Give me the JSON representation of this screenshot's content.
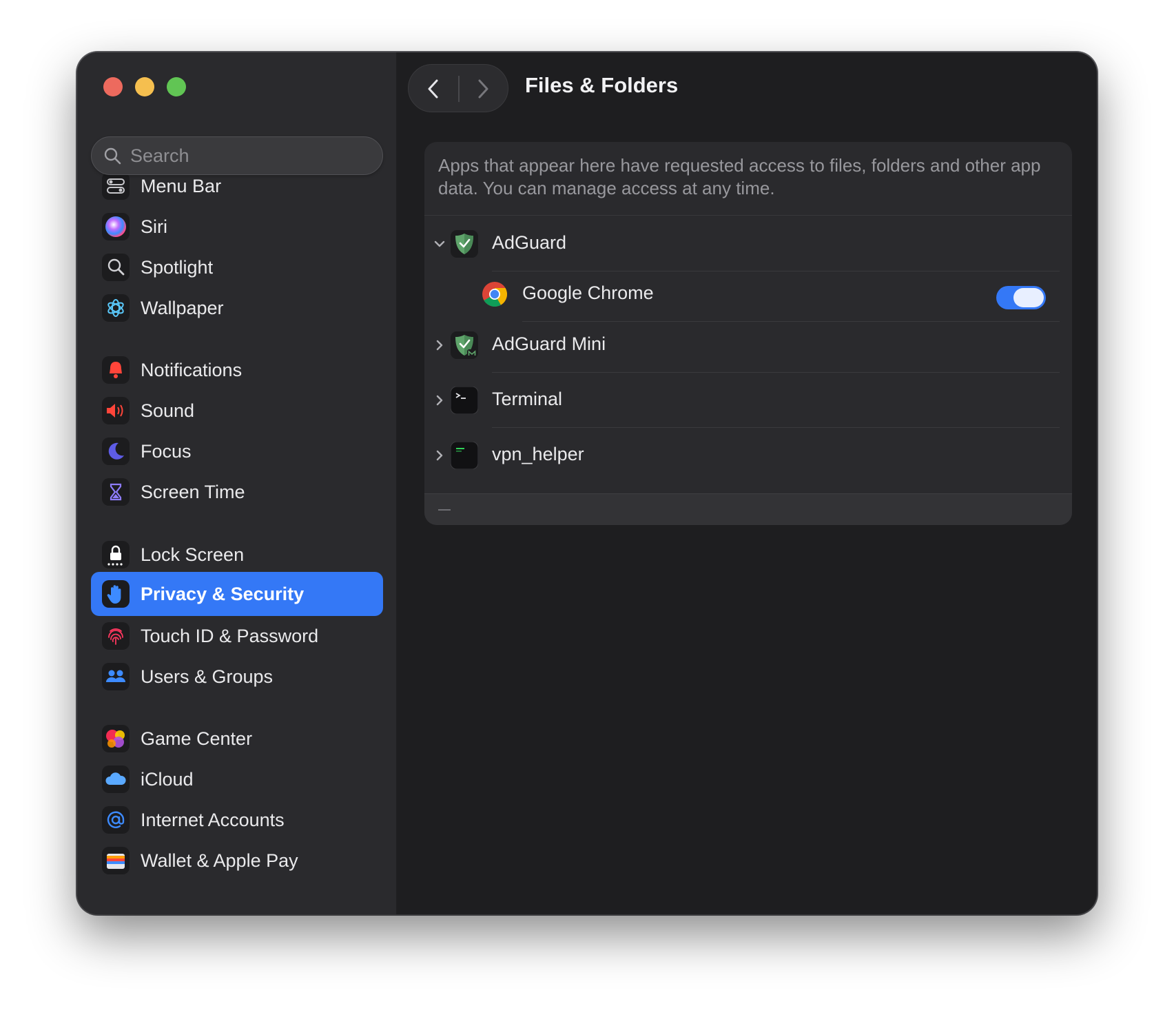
{
  "window": {
    "title": "Files & Folders"
  },
  "search": {
    "placeholder": "Search"
  },
  "sidebar": {
    "items": [
      {
        "label": "Menu Bar",
        "icon": "menu-bar-icon"
      },
      {
        "label": "Siri",
        "icon": "siri-icon"
      },
      {
        "label": "Spotlight",
        "icon": "spotlight-icon"
      },
      {
        "label": "Wallpaper",
        "icon": "wallpaper-icon"
      },
      {
        "label": "Notifications",
        "icon": "bell-icon"
      },
      {
        "label": "Sound",
        "icon": "speaker-icon"
      },
      {
        "label": "Focus",
        "icon": "moon-icon"
      },
      {
        "label": "Screen Time",
        "icon": "hourglass-icon"
      },
      {
        "label": "Lock Screen",
        "icon": "lock-icon"
      },
      {
        "label": "Privacy & Security",
        "icon": "hand-icon",
        "selected": true
      },
      {
        "label": "Touch ID & Password",
        "icon": "fingerprint-icon"
      },
      {
        "label": "Users & Groups",
        "icon": "users-icon"
      },
      {
        "label": "Game Center",
        "icon": "game-center-icon"
      },
      {
        "label": "iCloud",
        "icon": "cloud-icon"
      },
      {
        "label": "Internet Accounts",
        "icon": "at-icon"
      },
      {
        "label": "Wallet & Apple Pay",
        "icon": "wallet-icon"
      }
    ]
  },
  "main": {
    "description": "Apps that appear here have requested access to files, folders and other app data. You can manage access at any time.",
    "apps": [
      {
        "name": "AdGuard",
        "icon": "adguard-shield-icon",
        "expanded": true
      },
      {
        "name": "Google Chrome",
        "icon": "chrome-icon",
        "child": true,
        "enabled": true
      },
      {
        "name": "AdGuard Mini",
        "icon": "adguard-mini-icon",
        "expanded": false
      },
      {
        "name": "Terminal",
        "icon": "terminal-icon",
        "expanded": false
      },
      {
        "name": "vpn_helper",
        "icon": "exec-icon",
        "expanded": false
      }
    ],
    "footer": {
      "remove_icon": "minus-icon"
    }
  },
  "colors": {
    "accent": "#3478f6",
    "window_bg": "#1e1e20",
    "sidebar_bg": "#2a2a2d",
    "close": "#ed6a5e",
    "minimize": "#f5bf4f",
    "maximize": "#61c554"
  }
}
